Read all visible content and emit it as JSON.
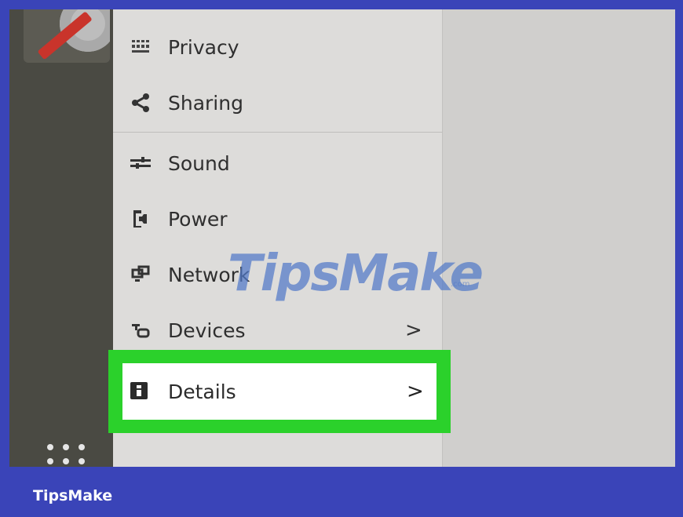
{
  "menu": {
    "items": [
      {
        "label": "Privacy",
        "icon": "privacy-grid-icon"
      },
      {
        "label": "Sharing",
        "icon": "share-icon"
      },
      {
        "label": "Sound",
        "icon": "sliders-icon"
      },
      {
        "label": "Power",
        "icon": "power-plug-icon"
      },
      {
        "label": "Network",
        "icon": "network-icon"
      },
      {
        "label": "Devices",
        "icon": "devices-icon",
        "chevron": ">"
      },
      {
        "label": "Details",
        "icon": "info-icon",
        "chevron": ">",
        "highlighted": true
      }
    ]
  },
  "watermark": {
    "text": "TipsMake",
    "suffix": ".com"
  },
  "footer": {
    "brand": "TipsMake"
  },
  "colors": {
    "frame": "#3a44b8",
    "highlight": "#2bd12b",
    "dock": "#4a4a43"
  }
}
